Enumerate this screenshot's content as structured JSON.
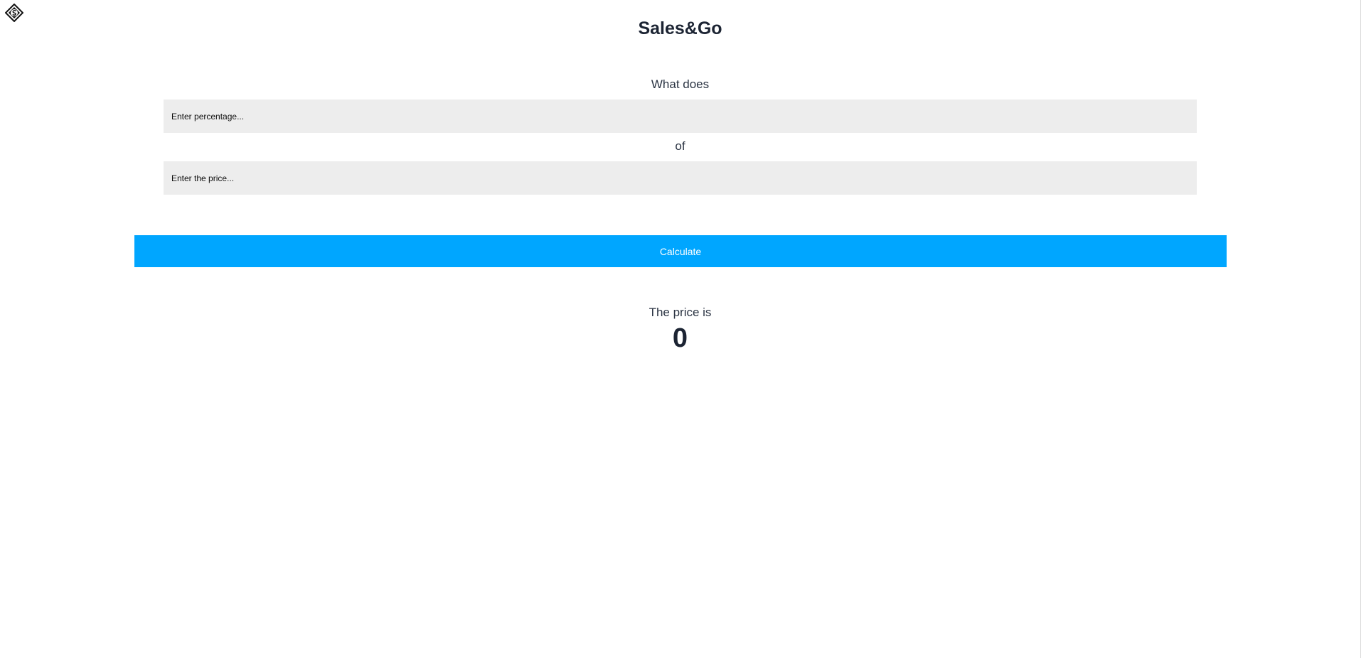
{
  "app": {
    "logo_icon": "diamond-s-logo-icon",
    "title": "Sales&Go"
  },
  "form": {
    "what_does_label": "What does",
    "percentage_placeholder": "Enter percentage...",
    "of_label": "of",
    "price_placeholder": "Enter the price...",
    "calculate_label": "Calculate"
  },
  "result": {
    "label": "The price is",
    "value": "0"
  },
  "colors": {
    "accent": "#00a6ff",
    "field_background": "#ededed",
    "title_text": "#1c2433"
  }
}
